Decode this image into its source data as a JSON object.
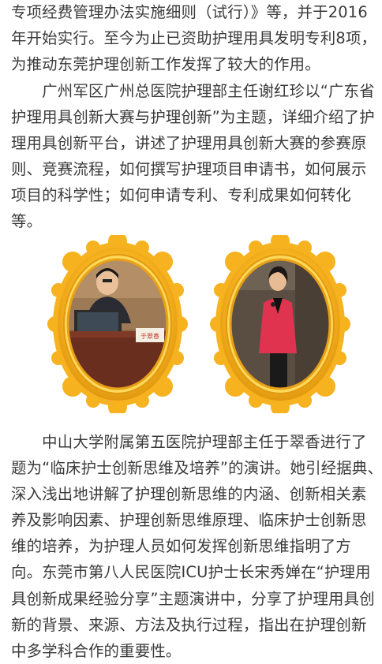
{
  "paragraph1": {
    "lines": [
      "专项经费管理办法实施细则（试行）》等，并于2016",
      "年开始实行。至今为止已资助护理用具发明专利8项，",
      "为推动东莞护理创新工作发挥了较大的作用。"
    ]
  },
  "paragraph2": {
    "lines": [
      "　　广州军区广州总医院护理部主任谢红珍以“广东省",
      "护理用具创新大赛与护理创新”为主题，详细介绍了护",
      "理用具创新平台，讲述了护理用具创新大赛的参赛原",
      "则、竞赛流程，如何撰写护理项目申请书，如何展示",
      "项目的科学性；如何申请专利、专利成果如何转化",
      "等。"
    ]
  },
  "paragraph3": {
    "lines": [
      "　　中山大学附属第五医院护理部主任于翠香进行了",
      "题为“临床护士创新思维及培养”的演讲。她引经据典、",
      "深入浅出地讲解了护理创新思维的内涵、创新相关素",
      "养及影响因素、护理创新思维原理、临床护士创新思",
      "维的培养，为护理人员如何发挥创新思维指明了方",
      "向。东莞市第八人民医院ICU护士长宋秀婵在“护理用",
      "具创新成果经验分享”主题演讲中，分享了护理用具创",
      "新的背景、来源、方法及执行过程，指出在护理创新",
      "中多学科合作的重要性。"
    ]
  },
  "photos": {
    "left_nameplate": "于翠香"
  },
  "colors": {
    "text": "#3a3a3a",
    "frame_gold": "#f6b21f",
    "frame_light": "#ffd95a",
    "frame_dark": "#d98e0a",
    "jacket_red": "#e0334f"
  }
}
